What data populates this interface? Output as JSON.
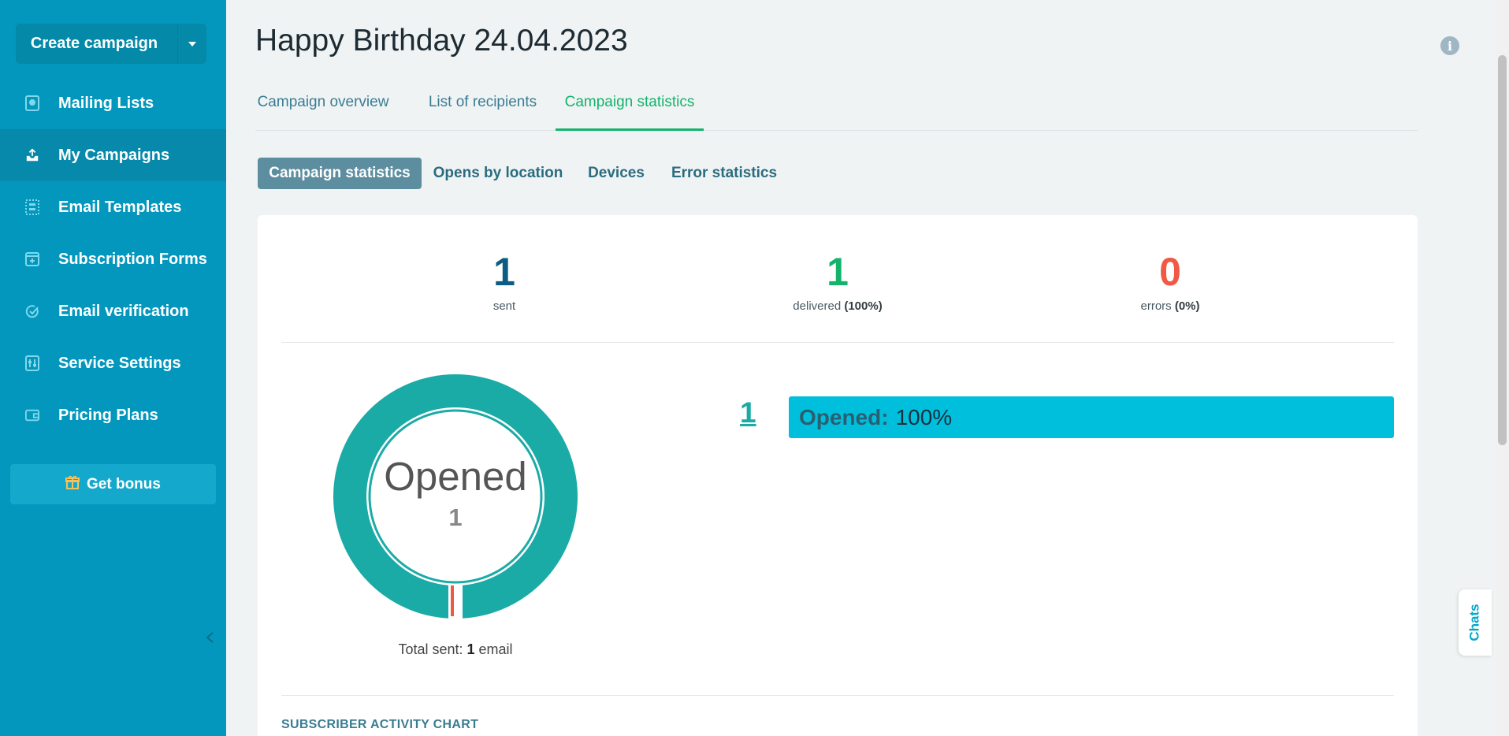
{
  "sidebar": {
    "create_label": "Create campaign",
    "items": [
      {
        "label": "Mailing Lists",
        "icon": "book-icon"
      },
      {
        "label": "My Campaigns",
        "icon": "upload-tray-icon"
      },
      {
        "label": "Email Templates",
        "icon": "template-icon"
      },
      {
        "label": "Subscription Forms",
        "icon": "form-icon"
      },
      {
        "label": "Email verification",
        "icon": "check-circle-icon"
      },
      {
        "label": "Service Settings",
        "icon": "sliders-icon"
      },
      {
        "label": "Pricing Plans",
        "icon": "wallet-icon"
      }
    ],
    "bonus_label": "Get bonus",
    "colors": {
      "background": "#0397bd",
      "active": "#0789ab"
    }
  },
  "header": {
    "title": "Happy Birthday 24.04.2023",
    "tabs": [
      "Campaign overview",
      "List of recipients",
      "Campaign statistics"
    ],
    "active_tab": "Campaign statistics"
  },
  "subtabs": {
    "items": [
      "Campaign statistics",
      "Opens by location",
      "Devices",
      "Error statistics"
    ],
    "active": "Campaign statistics"
  },
  "stats": {
    "sent": {
      "value": "1",
      "label": "sent",
      "color": "#0c5d83"
    },
    "delivered": {
      "value": "1",
      "label": "delivered",
      "percent": "(100%)",
      "color": "#13b36b"
    },
    "errors": {
      "value": "0",
      "label": "errors",
      "percent": "(0%)",
      "color": "#f05a44"
    }
  },
  "donut": {
    "title": "Opened",
    "count": "1",
    "total_prefix": "Total sent:",
    "total_value": "1",
    "total_suffix": "email",
    "color": "#1aaba6"
  },
  "bar": {
    "count": "1",
    "label": "Opened:",
    "value": "100%",
    "color": "#00bfdc"
  },
  "chart_heading": "SUBSCRIBER ACTIVITY CHART",
  "chats_label": "Chats",
  "chart_data": {
    "type": "pie",
    "title": "Opened",
    "categories": [
      "Opened"
    ],
    "values": [
      1
    ],
    "total": 1
  }
}
